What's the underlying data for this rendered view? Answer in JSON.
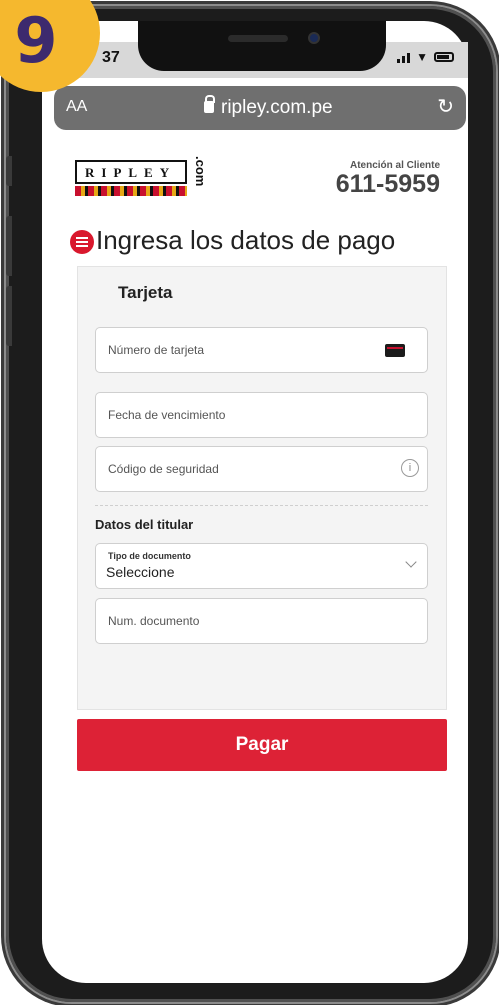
{
  "step": {
    "number": "9"
  },
  "status_bar": {
    "time": "37"
  },
  "browser": {
    "aa_label": "AA",
    "url": "ripley.com.pe",
    "reload_icon": "reload-icon"
  },
  "header": {
    "logo_text": "RIPLEY",
    "logo_suffix": ".com",
    "support_label": "Atención al Cliente",
    "support_phone": "611-5959"
  },
  "payment": {
    "title": "Ingresa los datos de pago",
    "card_section": "Tarjeta",
    "card_number_placeholder": "Número de tarjeta",
    "expiry_placeholder": "Fecha de vencimiento",
    "cvv_placeholder": "Código de seguridad",
    "holder_section": "Datos del titular",
    "document_type_label": "Tipo de documento",
    "document_type_value": "Seleccione",
    "document_number_placeholder": "Num. documento",
    "pay_button": "Pagar"
  },
  "colors": {
    "accent": "#dd2236",
    "badge": "#f5b82e",
    "badge_text": "#3d2a6e"
  }
}
